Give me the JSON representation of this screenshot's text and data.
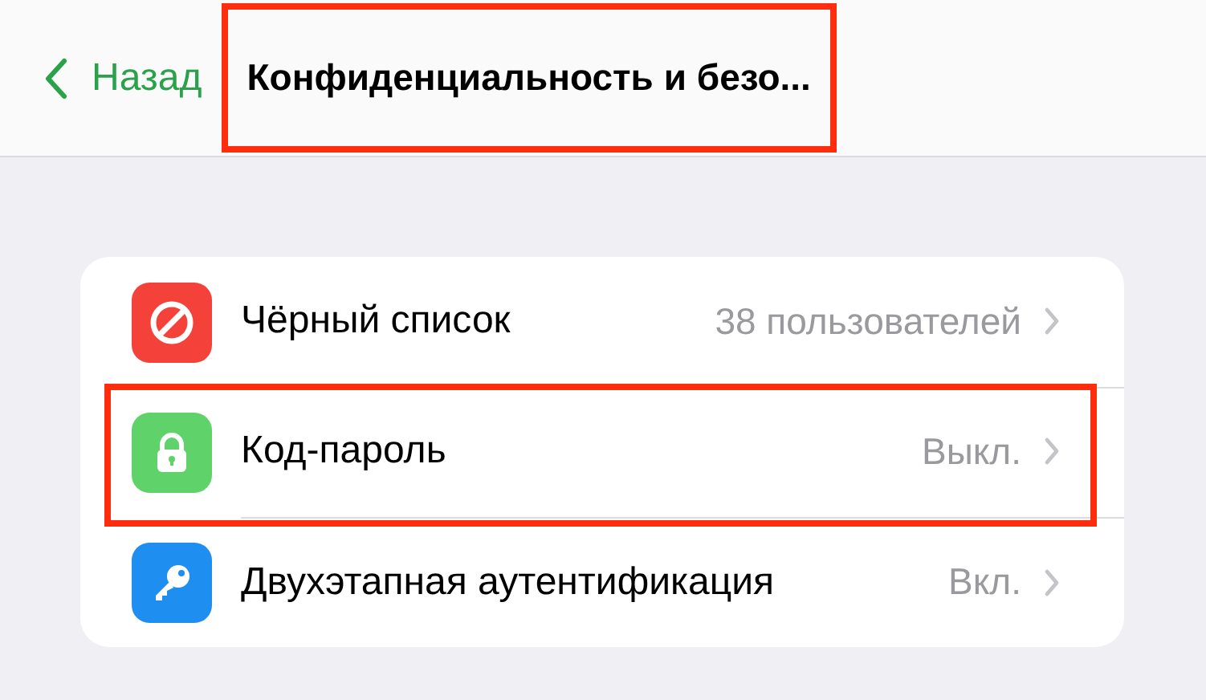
{
  "nav_bar": {
    "back_label": "Назад",
    "title": "Конфиденциальность и безо...",
    "title_highlighted": true
  },
  "settings": [
    {
      "kind": "blocked",
      "label": "Чёрный список",
      "value": "38 пользователей",
      "highlighted": false
    },
    {
      "kind": "lock",
      "label": "Код-пароль",
      "value": "Выкл.",
      "highlighted": true
    },
    {
      "kind": "key",
      "label": "Двухэтапная аутентификация",
      "value": "Вкл.",
      "highlighted": false
    }
  ]
}
